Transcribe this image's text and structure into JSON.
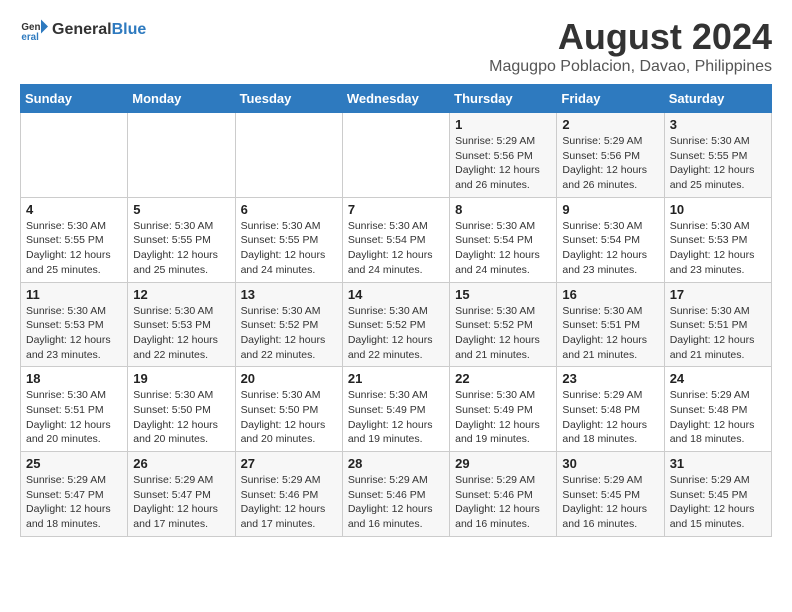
{
  "header": {
    "logo_general": "General",
    "logo_blue": "Blue",
    "title": "August 2024",
    "subtitle": "Magugpo Poblacion, Davao, Philippines"
  },
  "days_of_week": [
    "Sunday",
    "Monday",
    "Tuesday",
    "Wednesday",
    "Thursday",
    "Friday",
    "Saturday"
  ],
  "weeks": [
    {
      "days": [
        {
          "num": "",
          "info": ""
        },
        {
          "num": "",
          "info": ""
        },
        {
          "num": "",
          "info": ""
        },
        {
          "num": "",
          "info": ""
        },
        {
          "num": "1",
          "info": "Sunrise: 5:29 AM\nSunset: 5:56 PM\nDaylight: 12 hours\nand 26 minutes."
        },
        {
          "num": "2",
          "info": "Sunrise: 5:29 AM\nSunset: 5:56 PM\nDaylight: 12 hours\nand 26 minutes."
        },
        {
          "num": "3",
          "info": "Sunrise: 5:30 AM\nSunset: 5:55 PM\nDaylight: 12 hours\nand 25 minutes."
        }
      ]
    },
    {
      "days": [
        {
          "num": "4",
          "info": "Sunrise: 5:30 AM\nSunset: 5:55 PM\nDaylight: 12 hours\nand 25 minutes."
        },
        {
          "num": "5",
          "info": "Sunrise: 5:30 AM\nSunset: 5:55 PM\nDaylight: 12 hours\nand 25 minutes."
        },
        {
          "num": "6",
          "info": "Sunrise: 5:30 AM\nSunset: 5:55 PM\nDaylight: 12 hours\nand 24 minutes."
        },
        {
          "num": "7",
          "info": "Sunrise: 5:30 AM\nSunset: 5:54 PM\nDaylight: 12 hours\nand 24 minutes."
        },
        {
          "num": "8",
          "info": "Sunrise: 5:30 AM\nSunset: 5:54 PM\nDaylight: 12 hours\nand 24 minutes."
        },
        {
          "num": "9",
          "info": "Sunrise: 5:30 AM\nSunset: 5:54 PM\nDaylight: 12 hours\nand 23 minutes."
        },
        {
          "num": "10",
          "info": "Sunrise: 5:30 AM\nSunset: 5:53 PM\nDaylight: 12 hours\nand 23 minutes."
        }
      ]
    },
    {
      "days": [
        {
          "num": "11",
          "info": "Sunrise: 5:30 AM\nSunset: 5:53 PM\nDaylight: 12 hours\nand 23 minutes."
        },
        {
          "num": "12",
          "info": "Sunrise: 5:30 AM\nSunset: 5:53 PM\nDaylight: 12 hours\nand 22 minutes."
        },
        {
          "num": "13",
          "info": "Sunrise: 5:30 AM\nSunset: 5:52 PM\nDaylight: 12 hours\nand 22 minutes."
        },
        {
          "num": "14",
          "info": "Sunrise: 5:30 AM\nSunset: 5:52 PM\nDaylight: 12 hours\nand 22 minutes."
        },
        {
          "num": "15",
          "info": "Sunrise: 5:30 AM\nSunset: 5:52 PM\nDaylight: 12 hours\nand 21 minutes."
        },
        {
          "num": "16",
          "info": "Sunrise: 5:30 AM\nSunset: 5:51 PM\nDaylight: 12 hours\nand 21 minutes."
        },
        {
          "num": "17",
          "info": "Sunrise: 5:30 AM\nSunset: 5:51 PM\nDaylight: 12 hours\nand 21 minutes."
        }
      ]
    },
    {
      "days": [
        {
          "num": "18",
          "info": "Sunrise: 5:30 AM\nSunset: 5:51 PM\nDaylight: 12 hours\nand 20 minutes."
        },
        {
          "num": "19",
          "info": "Sunrise: 5:30 AM\nSunset: 5:50 PM\nDaylight: 12 hours\nand 20 minutes."
        },
        {
          "num": "20",
          "info": "Sunrise: 5:30 AM\nSunset: 5:50 PM\nDaylight: 12 hours\nand 20 minutes."
        },
        {
          "num": "21",
          "info": "Sunrise: 5:30 AM\nSunset: 5:49 PM\nDaylight: 12 hours\nand 19 minutes."
        },
        {
          "num": "22",
          "info": "Sunrise: 5:30 AM\nSunset: 5:49 PM\nDaylight: 12 hours\nand 19 minutes."
        },
        {
          "num": "23",
          "info": "Sunrise: 5:29 AM\nSunset: 5:48 PM\nDaylight: 12 hours\nand 18 minutes."
        },
        {
          "num": "24",
          "info": "Sunrise: 5:29 AM\nSunset: 5:48 PM\nDaylight: 12 hours\nand 18 minutes."
        }
      ]
    },
    {
      "days": [
        {
          "num": "25",
          "info": "Sunrise: 5:29 AM\nSunset: 5:47 PM\nDaylight: 12 hours\nand 18 minutes."
        },
        {
          "num": "26",
          "info": "Sunrise: 5:29 AM\nSunset: 5:47 PM\nDaylight: 12 hours\nand 17 minutes."
        },
        {
          "num": "27",
          "info": "Sunrise: 5:29 AM\nSunset: 5:46 PM\nDaylight: 12 hours\nand 17 minutes."
        },
        {
          "num": "28",
          "info": "Sunrise: 5:29 AM\nSunset: 5:46 PM\nDaylight: 12 hours\nand 16 minutes."
        },
        {
          "num": "29",
          "info": "Sunrise: 5:29 AM\nSunset: 5:46 PM\nDaylight: 12 hours\nand 16 minutes."
        },
        {
          "num": "30",
          "info": "Sunrise: 5:29 AM\nSunset: 5:45 PM\nDaylight: 12 hours\nand 16 minutes."
        },
        {
          "num": "31",
          "info": "Sunrise: 5:29 AM\nSunset: 5:45 PM\nDaylight: 12 hours\nand 15 minutes."
        }
      ]
    }
  ]
}
